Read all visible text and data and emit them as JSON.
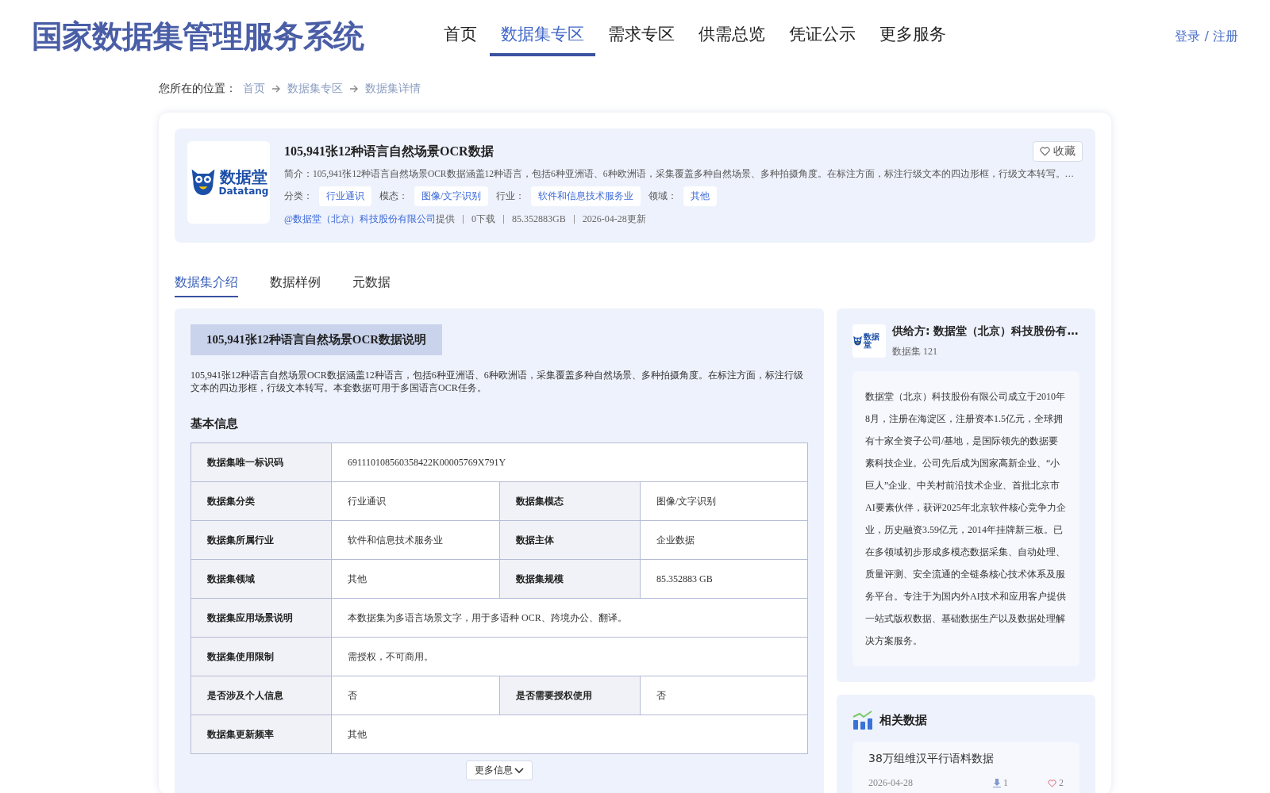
{
  "site": {
    "title": "国家数据集管理服务系统",
    "auth": "登录 / 注册"
  },
  "nav": [
    {
      "label": "首页",
      "selected": false
    },
    {
      "label": "数据集专区",
      "selected": true
    },
    {
      "label": "需求专区",
      "selected": false
    },
    {
      "label": "供需总览",
      "selected": false
    },
    {
      "label": "凭证公示",
      "selected": false
    },
    {
      "label": "更多服务",
      "selected": false
    }
  ],
  "breadcrumb": {
    "prefix": "您所在的位置：",
    "items": [
      "首页",
      "数据集专区",
      "数据集详情"
    ]
  },
  "dataset": {
    "logo": {
      "name": "数据堂",
      "latin": "Datatang"
    },
    "title": "105,941张12种语言自然场景OCR数据",
    "favorite": {
      "label": "收藏",
      "selected": false
    },
    "summary": "简介：105,941张12种语言自然场景OCR数据涵盖12种语言，包括6种亚洲语、6种欧洲语，采集覆盖多种自然场景、多种拍摄角度。在标注方面，标注行级文本的四边形框，行级文本转写。…",
    "tags": [
      {
        "label": "分类：",
        "value": "行业通识"
      },
      {
        "label": "模态：",
        "value": "图像/文字识别"
      },
      {
        "label": "行业：",
        "value": "软件和信息技术服务业"
      },
      {
        "label": "领域：",
        "value": "其他"
      }
    ],
    "provider": "@数据堂（北京）科技股份有限公司",
    "provider_suffix": "提供",
    "stats": [
      "0下载",
      "85.352883GB",
      "2026-04-28更新"
    ]
  },
  "tabs": [
    {
      "label": "数据集介绍",
      "selected": true
    },
    {
      "label": "数据样例",
      "selected": false
    },
    {
      "label": "元数据",
      "selected": false
    }
  ],
  "intro": {
    "heading": "105,941张12种语言自然场景OCR数据说明",
    "description": "105,941张12种语言自然场景OCR数据涵盖12种语言，包括6种亚洲语、6种欧洲语，采集覆盖多种自然场景、多种拍摄角度。在标注方面，标注行级文本的四边形框，行级文本转写。本套数据可用于多国语言OCR任务。",
    "basic_title": "基本信息",
    "table": [
      {
        "cells": [
          {
            "label": "数据集唯一标识码",
            "value": "691110108560358422K00005769X791Y"
          }
        ]
      },
      {
        "cells": [
          {
            "label": "数据集分类",
            "value": "行业通识"
          },
          {
            "label": "数据集模态",
            "value": "图像/文字识别"
          }
        ]
      },
      {
        "cells": [
          {
            "label": "数据集所属行业",
            "value": "软件和信息技术服务业"
          },
          {
            "label": "数据主体",
            "value": "企业数据"
          }
        ]
      },
      {
        "cells": [
          {
            "label": "数据集领域",
            "value": "其他"
          },
          {
            "label": "数据集规模",
            "value": "85.352883 GB"
          }
        ]
      },
      {
        "cells": [
          {
            "label": "数据集应用场景说明",
            "value": "本数据集为多语言场景文字，用于多语种 OCR、跨境办公、翻译。"
          }
        ]
      },
      {
        "cells": [
          {
            "label": "数据集使用限制",
            "value": "需授权，不可商用。"
          }
        ]
      },
      {
        "cells": [
          {
            "label": "是否涉及个人信息",
            "value": "否"
          },
          {
            "label": "是否需要授权使用",
            "value": "否"
          }
        ]
      },
      {
        "cells": [
          {
            "label": "数据集更新频率",
            "value": "其他"
          }
        ]
      }
    ],
    "more": "更多信息"
  },
  "supplier": {
    "logo": {
      "name": "数据堂"
    },
    "name": "供给方: 数据堂（北京）科技股份有…",
    "count": "数据集 121",
    "about": "数据堂（北京）科技股份有限公司成立于2010年8月，注册在海淀区，注册资本1.5亿元，全球拥有十家全资子公司/基地，是国际领先的数据要素科技企业。公司先后成为国家高新企业、“小巨人”企业、中关村前沿技术企业、首批北京市AI要素伙伴，获评2025年北京软件核心竞争力企业，历史融资3.59亿元，2014年挂牌新三板。已在多领域初步形成多模态数据采集、自动处理、质量评测、安全流通的全链条核心技术体系及服务平台。专注于为国内外AI技术和应用客户提供一站式版权数据、基础数据生产以及数据处理解决方案服务。"
  },
  "related": {
    "title": "相关数据",
    "items": [
      {
        "name": "38万组维汉平行语料数据",
        "date": "2026-04-28",
        "downloads": "1",
        "likes": "2"
      }
    ]
  }
}
